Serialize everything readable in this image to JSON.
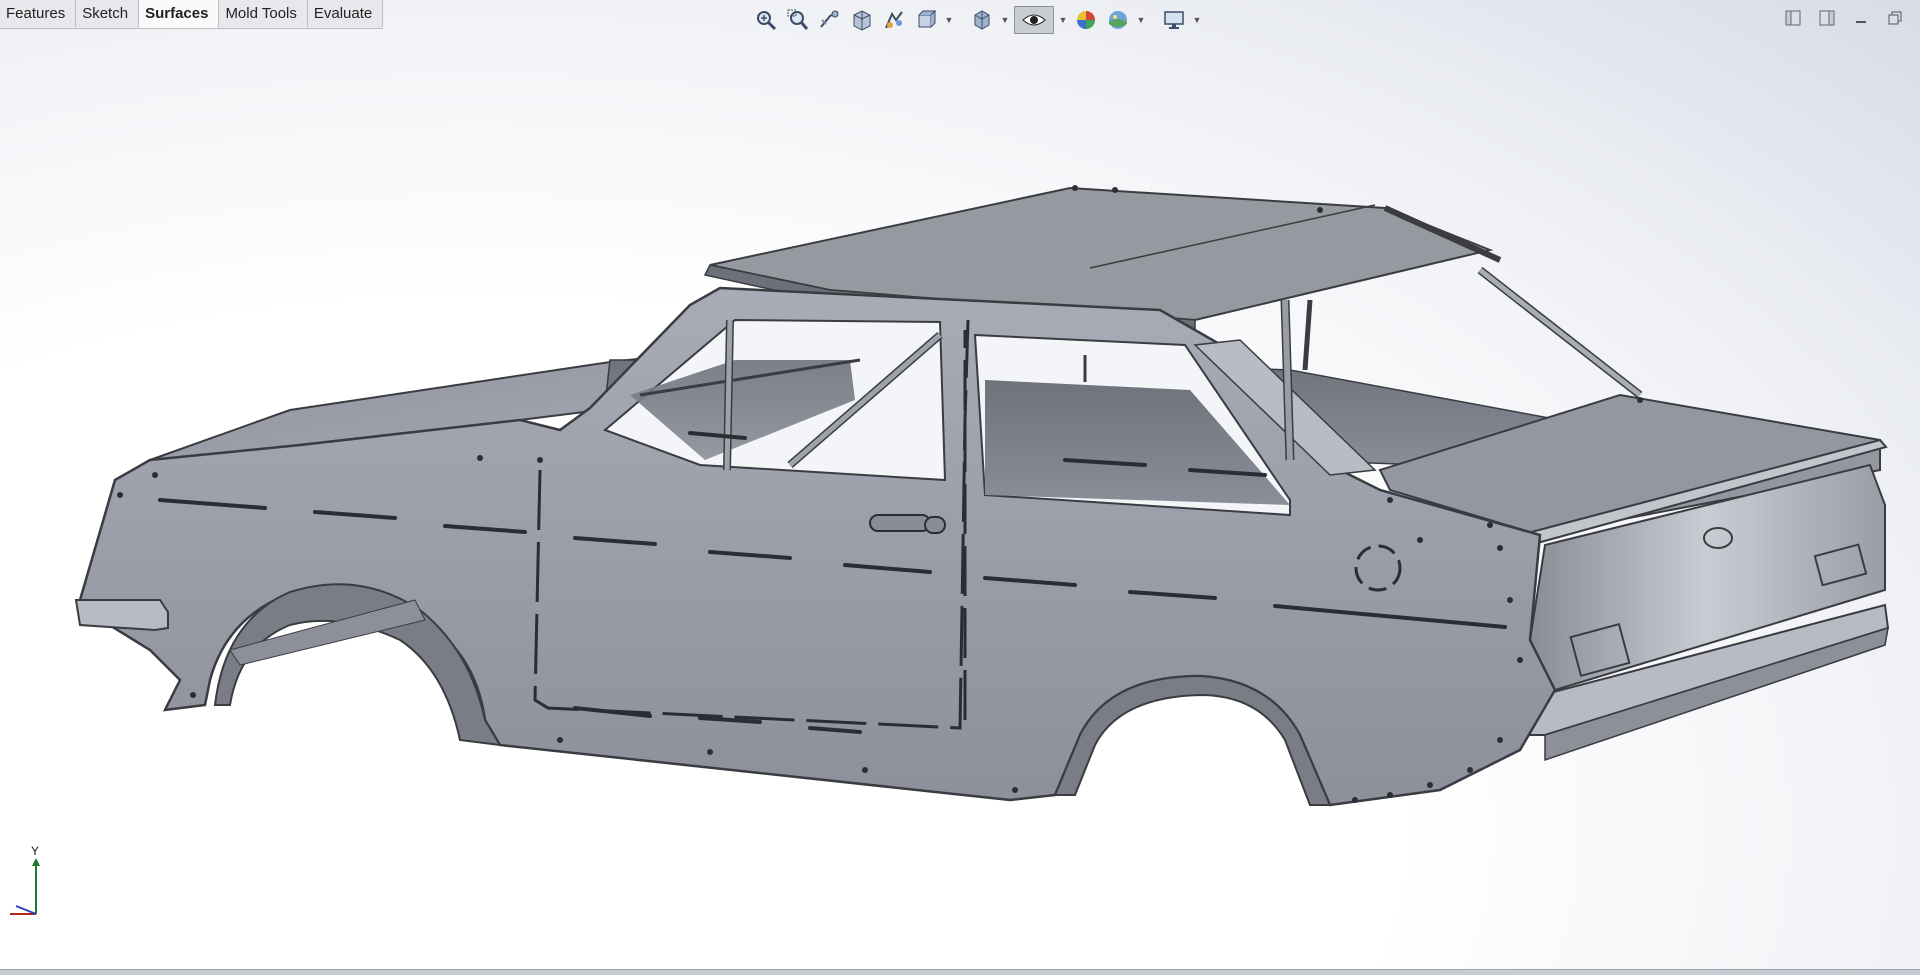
{
  "command_manager": {
    "tabs": [
      {
        "label": "Features",
        "active": false
      },
      {
        "label": "Sketch",
        "active": false
      },
      {
        "label": "Surfaces",
        "active": true
      },
      {
        "label": "Mold Tools",
        "active": false
      },
      {
        "label": "Evaluate",
        "active": false
      }
    ]
  },
  "heads_up_toolbar": {
    "tools": [
      {
        "icon": "zoom-to-fit-icon"
      },
      {
        "icon": "zoom-to-area-icon"
      },
      {
        "icon": "previous-view-icon"
      },
      {
        "icon": "section-view-icon"
      },
      {
        "icon": "dynamic-annotation-icon"
      },
      {
        "icon": "view-orientation-icon"
      },
      {
        "icon": "display-style-icon"
      },
      {
        "icon": "hide-show-items-icon"
      },
      {
        "icon": "edit-appearance-icon"
      },
      {
        "icon": "apply-scene-icon"
      },
      {
        "icon": "view-settings-icon"
      }
    ]
  },
  "triad": {
    "y_label": "Y"
  },
  "colors": {
    "model_fill": "#9a9da7",
    "model_dark": "#3a3c42",
    "accent_pressed": "#c9ccd3"
  }
}
